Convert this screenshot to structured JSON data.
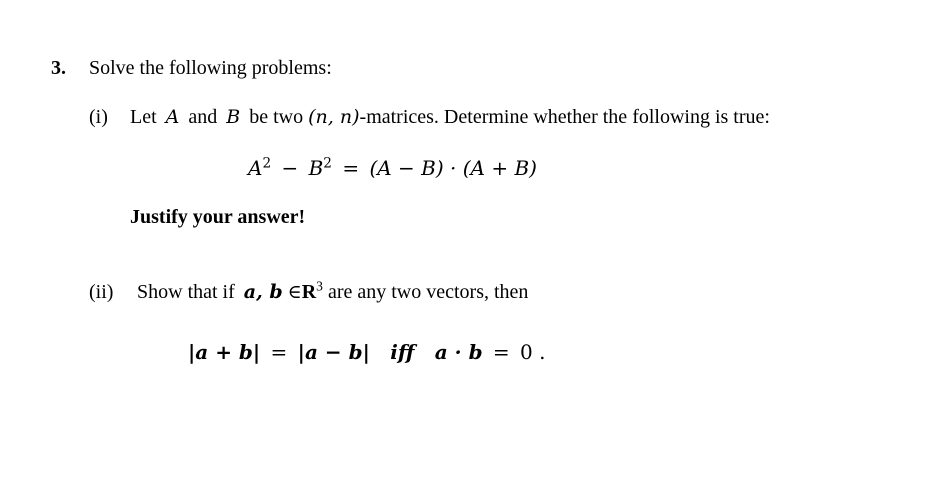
{
  "problem": {
    "number": "3.",
    "heading": "Solve the following problems:"
  },
  "part_i": {
    "label": "(i)",
    "text_let": "Let",
    "var_A": "A",
    "text_and": "and",
    "var_B": "B",
    "text_be_two": "be two",
    "dims": "(n, n)",
    "text_rest": "-matrices. Determine whether the following is true:",
    "equation": {
      "lhs_a": "A",
      "lhs_a_exp": "2",
      "minus": "−",
      "lhs_b": "B",
      "lhs_b_exp": "2",
      "equals": "=",
      "rhs": "(A − B) · (A + B)"
    },
    "instruction": "Justify your answer!"
  },
  "part_ii": {
    "label": "(ii)",
    "text_show": "Show that if",
    "vectors": "a, b",
    "elem": "∈",
    "space": "R",
    "space_exp": "3",
    "text_rest": "are any two vectors, then",
    "equation": {
      "lhs": "|a + b|",
      "equals": "=",
      "rhs": "|a − b|",
      "iff": "iff",
      "cond": "a · b",
      "cond_eq": "=",
      "zero": "0",
      "period": "."
    }
  }
}
